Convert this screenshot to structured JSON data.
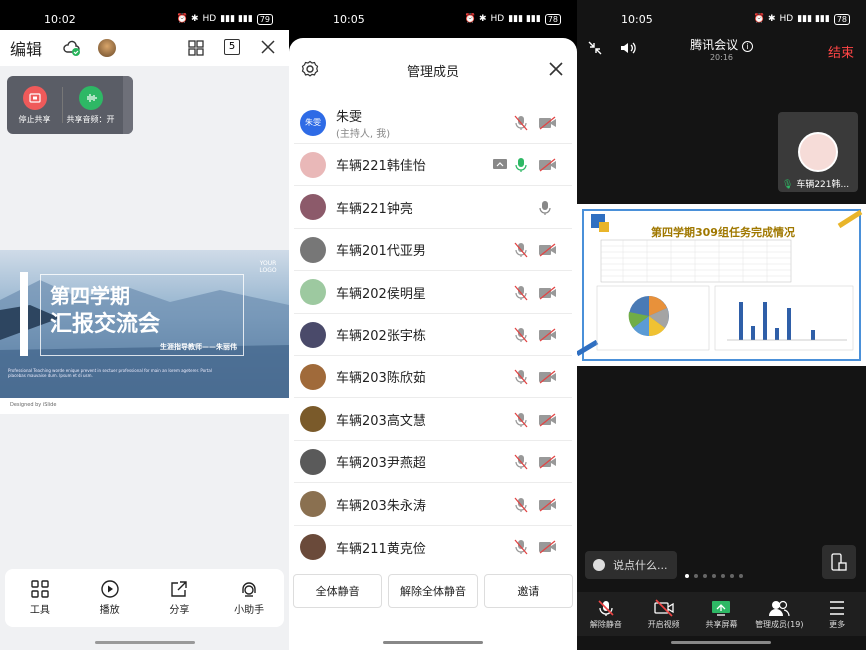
{
  "phone1": {
    "status": {
      "time": "10:02",
      "battery": "79"
    },
    "top": {
      "edit_label": "编辑",
      "page_count": "5"
    },
    "share_controls": {
      "stop_label": "停止共享",
      "audio_label": "共享音频：开"
    },
    "slide": {
      "title1": "第四学期",
      "title2": "汇报交流会",
      "subtitle": "生涯指导教师——朱丽伟",
      "logo": "YOUR LOGO",
      "small_text": "Professional Teaching worde enique prevent in sectuer professional for main an lorem ageterer. Portal placebas mauvaise dum. Ipsum et di usm.",
      "designed": "Designed by iSlide"
    },
    "tools": [
      {
        "label": "工具",
        "icon": "grid-icon"
      },
      {
        "label": "播放",
        "icon": "play-icon"
      },
      {
        "label": "分享",
        "icon": "share-icon"
      },
      {
        "label": "小助手",
        "icon": "assistant-icon"
      }
    ]
  },
  "phone2": {
    "status": {
      "time": "10:05",
      "battery": "78"
    },
    "title": "管理成员",
    "members": [
      {
        "name": "朱雯",
        "sub": "(主持人, 我)",
        "avatar": "朱雯",
        "avatar_color": "#2e6be6"
      },
      {
        "name": "车辆221韩佳怡",
        "sub": "",
        "avatar": "",
        "avatar_color": "#e9b8b8",
        "sharing": true,
        "mic": "green"
      },
      {
        "name": "车辆221钟亮",
        "sub": "",
        "avatar": "",
        "avatar_color": "#8c5a6a",
        "mic": "gray",
        "no_video": true
      },
      {
        "name": "车辆201代亚男",
        "sub": "",
        "avatar": "",
        "avatar_color": "#777"
      },
      {
        "name": "车辆202侯明星",
        "sub": "",
        "avatar": "",
        "avatar_color": "#9dc9a0"
      },
      {
        "name": "车辆202张宇栋",
        "sub": "",
        "avatar": "",
        "avatar_color": "#4a4a6a"
      },
      {
        "name": "车辆203陈欣茹",
        "sub": "",
        "avatar": "",
        "avatar_color": "#a06a3a"
      },
      {
        "name": "车辆203高文慧",
        "sub": "",
        "avatar": "",
        "avatar_color": "#7a5a2a"
      },
      {
        "name": "车辆203尹燕超",
        "sub": "",
        "avatar": "",
        "avatar_color": "#5a5a5a"
      },
      {
        "name": "车辆203朱永涛",
        "sub": "",
        "avatar": "",
        "avatar_color": "#8a7050"
      },
      {
        "name": "车辆211黄克俭",
        "sub": "",
        "avatar": "",
        "avatar_color": "#6a4a3a"
      }
    ],
    "buttons": {
      "mute_all": "全体静音",
      "unmute_all": "解除全体静音",
      "invite": "邀请"
    }
  },
  "phone3": {
    "status": {
      "time": "10:05",
      "battery": "78"
    },
    "title": "腾讯会议",
    "timer": "20:16",
    "end_label": "结束",
    "pip_name": "车辆221韩...",
    "shared_title": "第四学期309组任务完成情况",
    "chat_placeholder": "说点什么...",
    "bottom": [
      {
        "label": "解除静音",
        "icon": "mic-muted-icon"
      },
      {
        "label": "开启视频",
        "icon": "video-off-icon"
      },
      {
        "label": "共享屏幕",
        "icon": "share-screen-icon"
      },
      {
        "label": "管理成员(19)",
        "icon": "members-icon"
      },
      {
        "label": "更多",
        "icon": "more-icon"
      }
    ]
  }
}
